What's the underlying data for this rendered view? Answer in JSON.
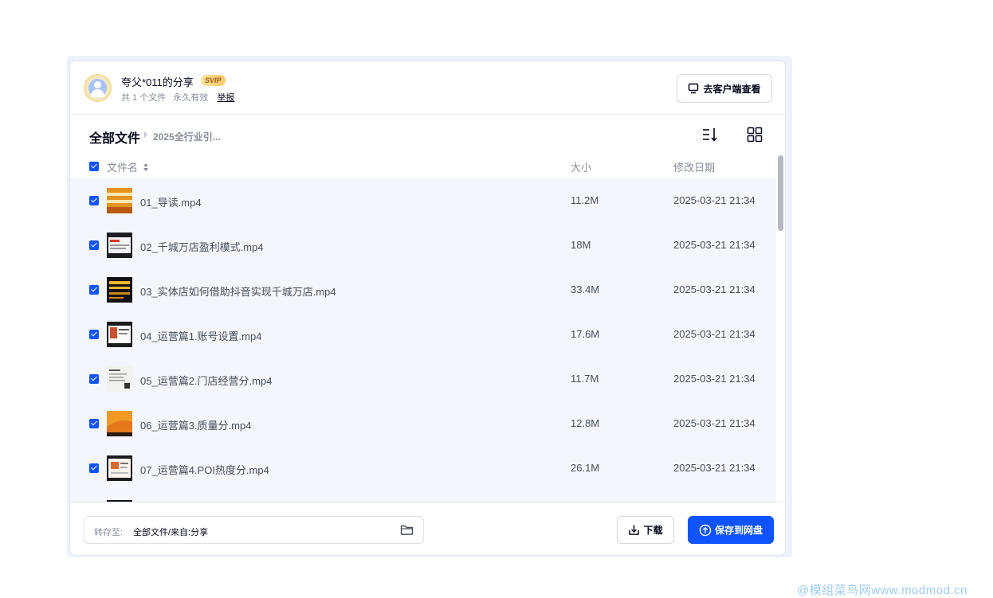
{
  "header": {
    "sharer": "夸父*011的分享",
    "badge": "SVIP",
    "file_count": "共 1 个文件",
    "validity": "永久有效",
    "report": "举报",
    "client_button": "去客户端查看"
  },
  "breadcrumb": {
    "root": "全部文件",
    "current": "2025全行业引..."
  },
  "columns": {
    "name": "文件名",
    "size": "大小",
    "date": "修改日期"
  },
  "files": [
    {
      "name": "01_导读.mp4",
      "size": "11.2M",
      "date": "2025-03-21 21:34",
      "checked": true
    },
    {
      "name": "02_千城万店盈利模式.mp4",
      "size": "18M",
      "date": "2025-03-21 21:34",
      "checked": true
    },
    {
      "name": "03_实体店如何借助抖音实现千城万店.mp4",
      "size": "33.4M",
      "date": "2025-03-21 21:34",
      "checked": true
    },
    {
      "name": "04_运营篇1.账号设置.mp4",
      "size": "17.6M",
      "date": "2025-03-21 21:34",
      "checked": true
    },
    {
      "name": "05_运营篇2.门店经营分.mp4",
      "size": "11.7M",
      "date": "2025-03-21 21:34",
      "checked": true
    },
    {
      "name": "06_运营篇3.质量分.mp4",
      "size": "12.8M",
      "date": "2025-03-21 21:34",
      "checked": true
    },
    {
      "name": "07_运营篇4.POI热度分.mp4",
      "size": "26.1M",
      "date": "2025-03-21 21:34",
      "checked": true
    }
  ],
  "footer": {
    "save_to_label": "转存至:",
    "save_to_value": "全部文件/来自:分享",
    "download": "下载",
    "save": "保存到网盘"
  },
  "watermark": "@模组菜鸟网www.modmod.cn",
  "colors": {
    "accent": "#0d53ff",
    "list_bg": "#f5f6fc"
  }
}
